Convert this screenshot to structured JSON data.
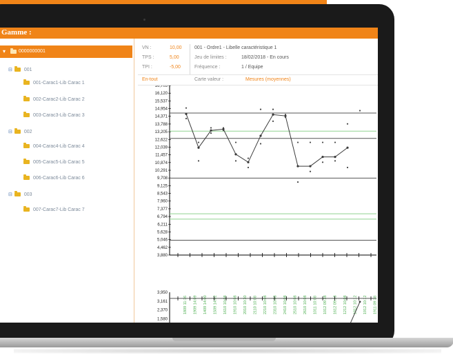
{
  "header": {
    "title": "Gamme :"
  },
  "tree": {
    "root": {
      "label": "0000000001"
    },
    "groups": [
      {
        "label": "001",
        "children": [
          "001-Carac1-Lib Carac 1",
          "002-Carac2-Lib Carac 2",
          "003-Carac3-Lib Carac 3"
        ]
      },
      {
        "label": "002",
        "children": [
          "004-Carac4-Lib Carac 4",
          "005-Carac5-Lib Carac 5",
          "006-Carac6-Lib Carac 6"
        ]
      },
      {
        "label": "003",
        "children": [
          "007-Carac7-Lib Carac 7"
        ]
      }
    ]
  },
  "info": {
    "vn_label": "VN :",
    "vn_value": "10,00",
    "tps_label": "TPS :",
    "tps_value": "5,00",
    "tpi_label": "TPI :",
    "tpi_value": "-5,00",
    "caracteristique": "001 - Ordre1 - Libelle caractéristique 1",
    "jeu_label": "Jeu de limites :",
    "jeu_value": "18/02/2018 - En cours",
    "freq_label": "Fréquence :",
    "freq_value": "1 / Equipe"
  },
  "filter": {
    "mode": "En-tout",
    "carte_label": "Carte valeur :",
    "carte_value": "Mesures (moyennes)"
  },
  "colors": {
    "accent": "#f08418",
    "limit_green": "#8fd28f",
    "series": "#3a3a3a",
    "date_green": "#4caf50"
  },
  "chart_data": [
    {
      "type": "line",
      "name": "Carte moyennes",
      "yticks": [
        "16,703",
        "16,120",
        "15,537",
        "14,954",
        "14,371",
        "13,788",
        "13,205",
        "12,622",
        "12,039",
        "11,457",
        "10,874",
        "10,291",
        "9,708",
        "9,125",
        "8,543",
        "7,960",
        "7,377",
        "6,794",
        "6,211",
        "5,628",
        "5,046",
        "4,462",
        "3,880"
      ],
      "ylim": [
        3.88,
        16.703
      ],
      "x": [
        "1809 11:16",
        "1909 14:09",
        "1409 14:00",
        "1509 14:02",
        "1610 10:08",
        "1910 10:08",
        "2010 10:30",
        "2110 10:08",
        "2210 10:08",
        "2310 10:08",
        "2410 10:08",
        "2510 10:08",
        "2610 10:08",
        "1011 10:08",
        "1012 09:38",
        "1612 09:18",
        "1212 10:08",
        "1812 10:12",
        "1912 10:12",
        "1911 09:38"
      ],
      "mean": [
        14.55,
        12.0,
        13.3,
        13.4,
        11.5,
        10.9,
        12.9,
        14.5,
        14.4,
        10.6,
        10.6,
        11.3,
        11.3,
        12.0,
        null
      ],
      "points_high": [
        15.0,
        12.4,
        13.5,
        13.5,
        12.4,
        11.2,
        14.9,
        14.9,
        14.5,
        12.4,
        12.4,
        12.4,
        12.4,
        13.8,
        14.8
      ],
      "points_low": [
        14.2,
        11.0,
        13.1,
        13.3,
        11.0,
        10.5,
        12.3,
        14.0,
        14.3,
        9.4,
        10.2,
        10.9,
        11.0,
        10.5,
        null
      ],
      "lines": [
        14.62,
        13.25,
        12.7,
        9.7,
        7.0,
        6.6,
        5.0
      ]
    },
    {
      "type": "line",
      "name": "Carte étendues",
      "yticks": [
        "3,950",
        "3,161",
        "2,370",
        "1,580",
        "0,790",
        "0,000"
      ],
      "ylim": [
        0,
        3.95
      ],
      "values": [
        0.6,
        0.5,
        0.4,
        0.3,
        0.3,
        0.2,
        0.2,
        0.3,
        0.4,
        0.5,
        0.3,
        0.2,
        0.3,
        0.6,
        3.1
      ]
    }
  ]
}
